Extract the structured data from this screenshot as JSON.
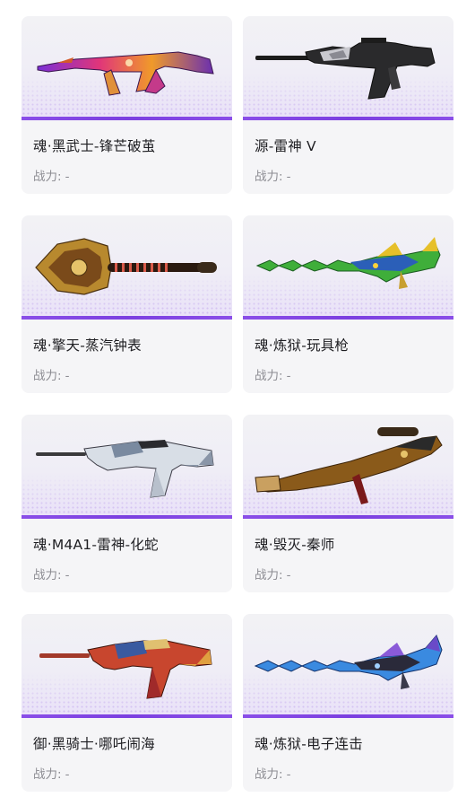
{
  "cards": [
    {
      "name": "魂·黑武士-锋芒破茧",
      "power_label": "战力:",
      "power_value": "-",
      "weapon_icon": "rifle-ak-icon"
    },
    {
      "name": "源-雷神 V",
      "power_label": "战力:",
      "power_value": "-",
      "weapon_icon": "rifle-m4-icon"
    },
    {
      "name": "魂·擎天-蒸汽钟表",
      "power_label": "战力:",
      "power_value": "-",
      "weapon_icon": "shovel-icon"
    },
    {
      "name": "魂·炼狱-玩具枪",
      "power_label": "战力:",
      "power_value": "-",
      "weapon_icon": "gatling-dragon-icon"
    },
    {
      "name": "魂·M4A1-雷神-化蛇",
      "power_label": "战力:",
      "power_value": "-",
      "weapon_icon": "rifle-m4a1-icon"
    },
    {
      "name": "魂·毁灭-秦师",
      "power_label": "战力:",
      "power_value": "-",
      "weapon_icon": "sniper-rifle-icon"
    },
    {
      "name": "御·黑骑士·哪吒闹海",
      "power_label": "战力:",
      "power_value": "-",
      "weapon_icon": "rifle-m4-red-icon"
    },
    {
      "name": "魂·炼狱-电子连击",
      "power_label": "战力:",
      "power_value": "-",
      "weapon_icon": "gatling-dragon-blue-icon"
    }
  ],
  "colors": {
    "card_bg": "#f5f5f7",
    "accent_bar": "#7b3fe0",
    "name_text": "#1e1e22",
    "power_text": "#8c8c92"
  }
}
